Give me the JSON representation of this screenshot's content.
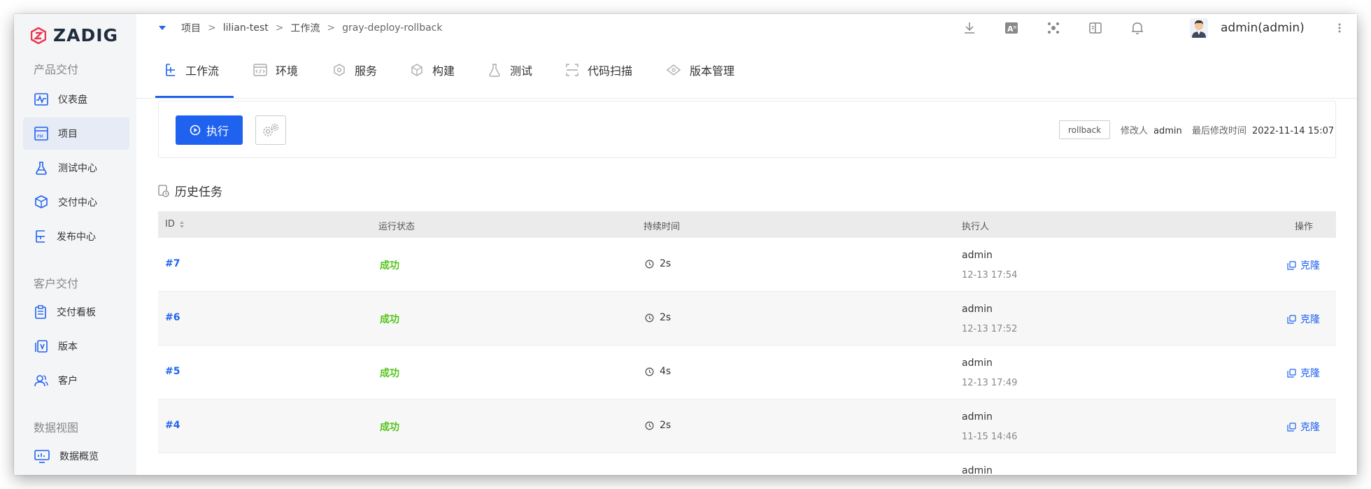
{
  "app": {
    "logo_text": "ZADIG"
  },
  "sidebar": {
    "section1": "产品交付",
    "items1": [
      {
        "label": "仪表盘",
        "icon": "dashboard-icon"
      },
      {
        "label": "项目",
        "icon": "project-icon",
        "active": true
      },
      {
        "label": "测试中心",
        "icon": "flask-icon"
      },
      {
        "label": "交付中心",
        "icon": "delivery-icon"
      },
      {
        "label": "发布中心",
        "icon": "release-icon"
      }
    ],
    "section2": "客户交付",
    "items2": [
      {
        "label": "交付看板",
        "icon": "clipboard-icon"
      },
      {
        "label": "版本",
        "icon": "version-icon"
      },
      {
        "label": "客户",
        "icon": "customers-icon"
      }
    ],
    "section3": "数据视图",
    "items3": [
      {
        "label": "数据概览",
        "icon": "monitor-icon"
      }
    ]
  },
  "breadcrumb": {
    "items": [
      "项目",
      "lilian-test",
      "工作流",
      "gray-deploy-rollback"
    ],
    "separator": ">"
  },
  "header": {
    "user": "admin(admin)",
    "icons": [
      "download-icon",
      "translate-icon",
      "plugin-icon",
      "docs-icon",
      "bell-icon",
      "avatar",
      "more-icon"
    ]
  },
  "tabs": [
    {
      "label": "工作流",
      "icon": "workflow-icon",
      "active": true
    },
    {
      "label": "环境",
      "icon": "environment-icon"
    },
    {
      "label": "服务",
      "icon": "service-icon"
    },
    {
      "label": "构建",
      "icon": "build-icon"
    },
    {
      "label": "测试",
      "icon": "test-icon"
    },
    {
      "label": "代码扫描",
      "icon": "scan-icon"
    },
    {
      "label": "版本管理",
      "icon": "version-manage-icon"
    }
  ],
  "workflow": {
    "run_label": "执行",
    "tag": "rollback",
    "modifier_label": "修改人",
    "modifier": "admin",
    "modified_time_label": "最后修改时间",
    "modified_time": "2022-11-14 15:07"
  },
  "history": {
    "title": "历史任务",
    "columns": [
      "ID",
      "运行状态",
      "持续时间",
      "执行人",
      "操作"
    ],
    "rows": [
      {
        "id": "#7",
        "status": "成功",
        "duration": "2s",
        "executor": "admin",
        "time": "12-13 17:54",
        "action": "克隆"
      },
      {
        "id": "#6",
        "status": "成功",
        "duration": "2s",
        "executor": "admin",
        "time": "12-13 17:52",
        "action": "克隆"
      },
      {
        "id": "#5",
        "status": "成功",
        "duration": "4s",
        "executor": "admin",
        "time": "12-13 17:49",
        "action": "克隆"
      },
      {
        "id": "#4",
        "status": "成功",
        "duration": "2s",
        "executor": "admin",
        "time": "11-15 14:46",
        "action": "克隆"
      },
      {
        "id": "",
        "status": "",
        "duration": "",
        "executor": "admin",
        "time": "",
        "action": ""
      }
    ]
  },
  "colors": {
    "accent": "#1f62f0",
    "success": "#52c41a",
    "logo": "#e8384f"
  }
}
